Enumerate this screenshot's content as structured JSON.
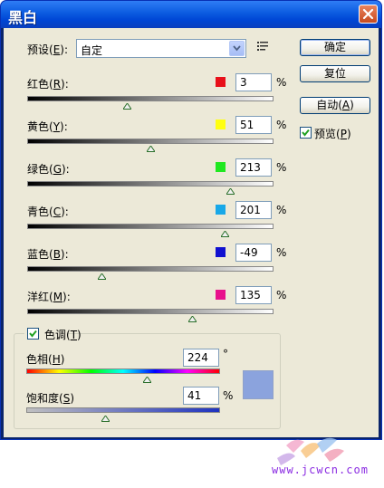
{
  "window": {
    "title": "黑白"
  },
  "preset": {
    "label": "预设(E):",
    "label_prefix": "预设(",
    "mnemonic": "E",
    "label_suffix": "):",
    "value": "自定"
  },
  "sliders": [
    {
      "prefix": "红色(",
      "mnemonic": "R",
      "suffix": "):",
      "value": "3",
      "swatch": "#e8101a",
      "level": 3
    },
    {
      "prefix": "黄色(",
      "mnemonic": "Y",
      "suffix": "):",
      "value": "51",
      "swatch": "#ffff10",
      "level": 51
    },
    {
      "prefix": "绿色(",
      "mnemonic": "G",
      "suffix": "):",
      "value": "213",
      "swatch": "#20e820",
      "level": 213
    },
    {
      "prefix": "青色(",
      "mnemonic": "C",
      "suffix": "):",
      "value": "201",
      "swatch": "#18a8e8",
      "level": 201
    },
    {
      "prefix": "蓝色(",
      "mnemonic": "B",
      "suffix": "):",
      "value": "-49",
      "swatch": "#1010d0",
      "level": -49
    },
    {
      "prefix": "洋红(",
      "mnemonic": "M",
      "suffix": "):",
      "value": "135",
      "swatch": "#e8108c",
      "level": 135
    }
  ],
  "slider_range": {
    "min": -200,
    "max": 300
  },
  "percent_sign": "%",
  "buttons": {
    "ok": "确定",
    "reset": "复位",
    "auto_prefix": "自动(",
    "auto_mnemonic": "A",
    "auto_suffix": ")"
  },
  "preview": {
    "prefix": "预览(",
    "mnemonic": "P",
    "suffix": ")",
    "checked": true
  },
  "tint": {
    "prefix": "色调(",
    "mnemonic": "T",
    "suffix": ")",
    "checked": true,
    "hue": {
      "prefix": "色相(",
      "mnemonic": "H",
      "suffix": ")",
      "value": "224",
      "unit": "°",
      "level": 224,
      "max": 360
    },
    "saturation": {
      "prefix": "饱和度(",
      "mnemonic": "S",
      "suffix": ")",
      "value": "41",
      "unit": "%",
      "level": 41,
      "max": 100
    },
    "color": "#8ba3dd"
  },
  "watermark": {
    "text": "www.jcwcn.com"
  }
}
